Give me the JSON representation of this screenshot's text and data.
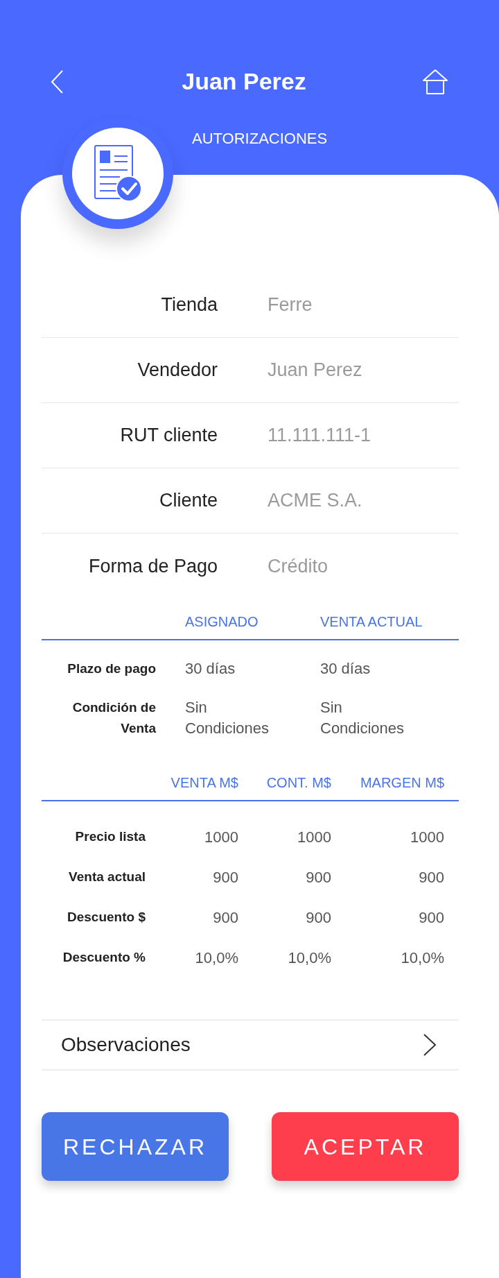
{
  "header": {
    "title": "Juan Perez",
    "subtitle": "AUTORIZACIONES"
  },
  "fields": [
    {
      "label": "Tienda",
      "value": "Ferre"
    },
    {
      "label": "Vendedor",
      "value": "Juan Perez"
    },
    {
      "label": "RUT cliente",
      "value": "11.111.111-1"
    },
    {
      "label": "Cliente",
      "value": "ACME S.A."
    },
    {
      "label": "Forma de Pago",
      "value": "Crédito"
    }
  ],
  "terms_table": {
    "columns": [
      "ASIGNADO",
      "VENTA ACTUAL"
    ],
    "rows": [
      {
        "label": "Plazo de pago",
        "values": [
          "30 días",
          "30 días"
        ]
      },
      {
        "label": "Condición de Venta",
        "values": [
          "Sin Condiciones",
          "Sin Condiciones"
        ]
      }
    ]
  },
  "amounts_table": {
    "columns": [
      "VENTA M$",
      "CONT. M$",
      "MARGEN M$"
    ],
    "rows": [
      {
        "label": "Precio lista",
        "values": [
          "1000",
          "1000",
          "1000"
        ]
      },
      {
        "label": "Venta actual",
        "values": [
          "900",
          "900",
          "900"
        ]
      },
      {
        "label": "Descuento $",
        "values": [
          "900",
          "900",
          "900"
        ]
      },
      {
        "label": "Descuento %",
        "values": [
          "10,0%",
          "10,0%",
          "10,0%"
        ]
      }
    ]
  },
  "observations": {
    "label": "Observaciones"
  },
  "buttons": [
    {
      "label": "RECHAZAR",
      "kind": "reject"
    },
    {
      "label": "ACEPTAR",
      "kind": "accept"
    }
  ]
}
